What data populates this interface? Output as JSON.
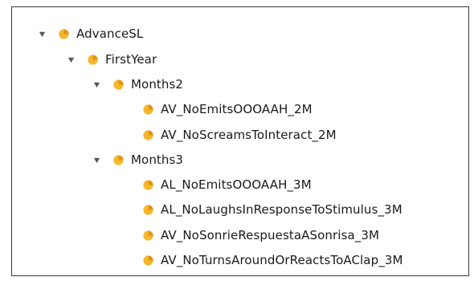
{
  "tree": {
    "root": {
      "label": "AdvanceSL",
      "icon": "ontology-class-icon",
      "expanded": true,
      "children": [
        {
          "label": "FirstYear",
          "icon": "ontology-class-icon",
          "expanded": true,
          "children": [
            {
              "label": "Months2",
              "icon": "ontology-class-icon",
              "expanded": true,
              "children": [
                {
                  "label": "AV_NoEmitsOOOAAH_2M",
                  "icon": "ontology-class-icon"
                },
                {
                  "label": "AV_NoScreamsToInteract_2M",
                  "icon": "ontology-class-icon"
                }
              ]
            },
            {
              "label": "Months3",
              "icon": "ontology-class-icon",
              "expanded": true,
              "children": [
                {
                  "label": "AL_NoEmitsOOOAAH_3M",
                  "icon": "ontology-class-icon"
                },
                {
                  "label": "AL_NoLaughsInResponseToStimulus_3M",
                  "icon": "ontology-class-icon"
                },
                {
                  "label": "AV_NoSonrieRespuestaASonrisa_3M",
                  "icon": "ontology-class-icon"
                },
                {
                  "label": "AV_NoTurnsAroundOrReactsToAClap_3M",
                  "icon": "ontology-class-icon"
                }
              ]
            }
          ]
        }
      ]
    }
  },
  "colors": {
    "icon_fill": "#f5b72e",
    "icon_shade": "#e39412",
    "toggle": "#555555"
  }
}
